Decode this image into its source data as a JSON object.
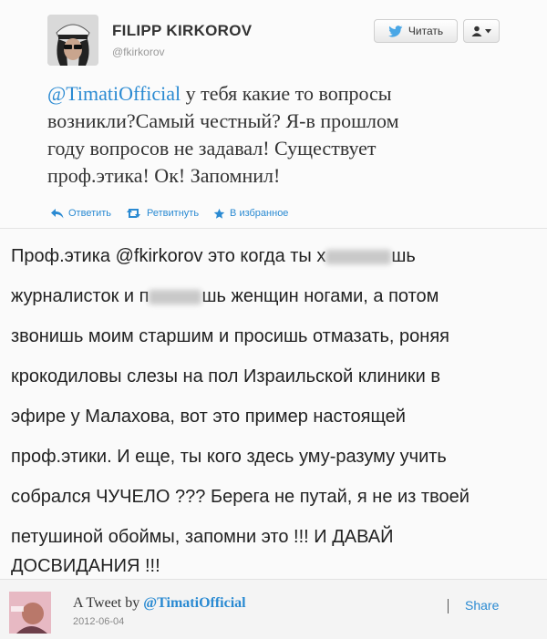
{
  "tweet": {
    "author_name": "FILIPP KIRKOROV",
    "author_handle": "@fkirkorov",
    "follow_label": "Читать",
    "mention": "@TimatiOfficial",
    "text_lines": [
      " у тебя какие то вопросы",
      "возникли?Самый честный? Я-в прошлом",
      "году вопросов не задавал! Существует",
      "проф.этика! Ок! Запомнил!"
    ],
    "actions": {
      "reply": "Ответить",
      "retweet": "Ретвитнуть",
      "favorite": "В избранное"
    }
  },
  "reply": {
    "line1": {
      "before": "Проф.этика @fkirkorov это когда ты х",
      "after": "шь"
    },
    "line2": {
      "before": "журналисток и п",
      "after": "шь женщин ногами, а потом"
    },
    "lines": [
      "звонишь моим старшим и просишь отмазать, роняя",
      "крокодиловы слезы на пол Израильской клиники в",
      "эфире у Малахова, вот это пример настоящей",
      "проф.этики. И еще, ты кого здесь уму-разуму учить",
      "собрался ЧУЧЕЛО ??? Берега не путай, я не из твоей",
      "петушиной обоймы, запомни это !!! И ДАВАЙ",
      "ДОСВИДАНИЯ !!!"
    ]
  },
  "footer": {
    "by_prefix": "A Tweet by ",
    "by_author": "@TimatiOfficial",
    "date": "2012-06-04",
    "share": "Share"
  },
  "colors": {
    "link": "#2a8ad2",
    "twitter_bird": "#4aa7e6"
  },
  "icons": [
    "twitter-bird-icon",
    "user-icon",
    "caret-down-icon",
    "reply-icon",
    "retweet-icon",
    "star-icon"
  ]
}
